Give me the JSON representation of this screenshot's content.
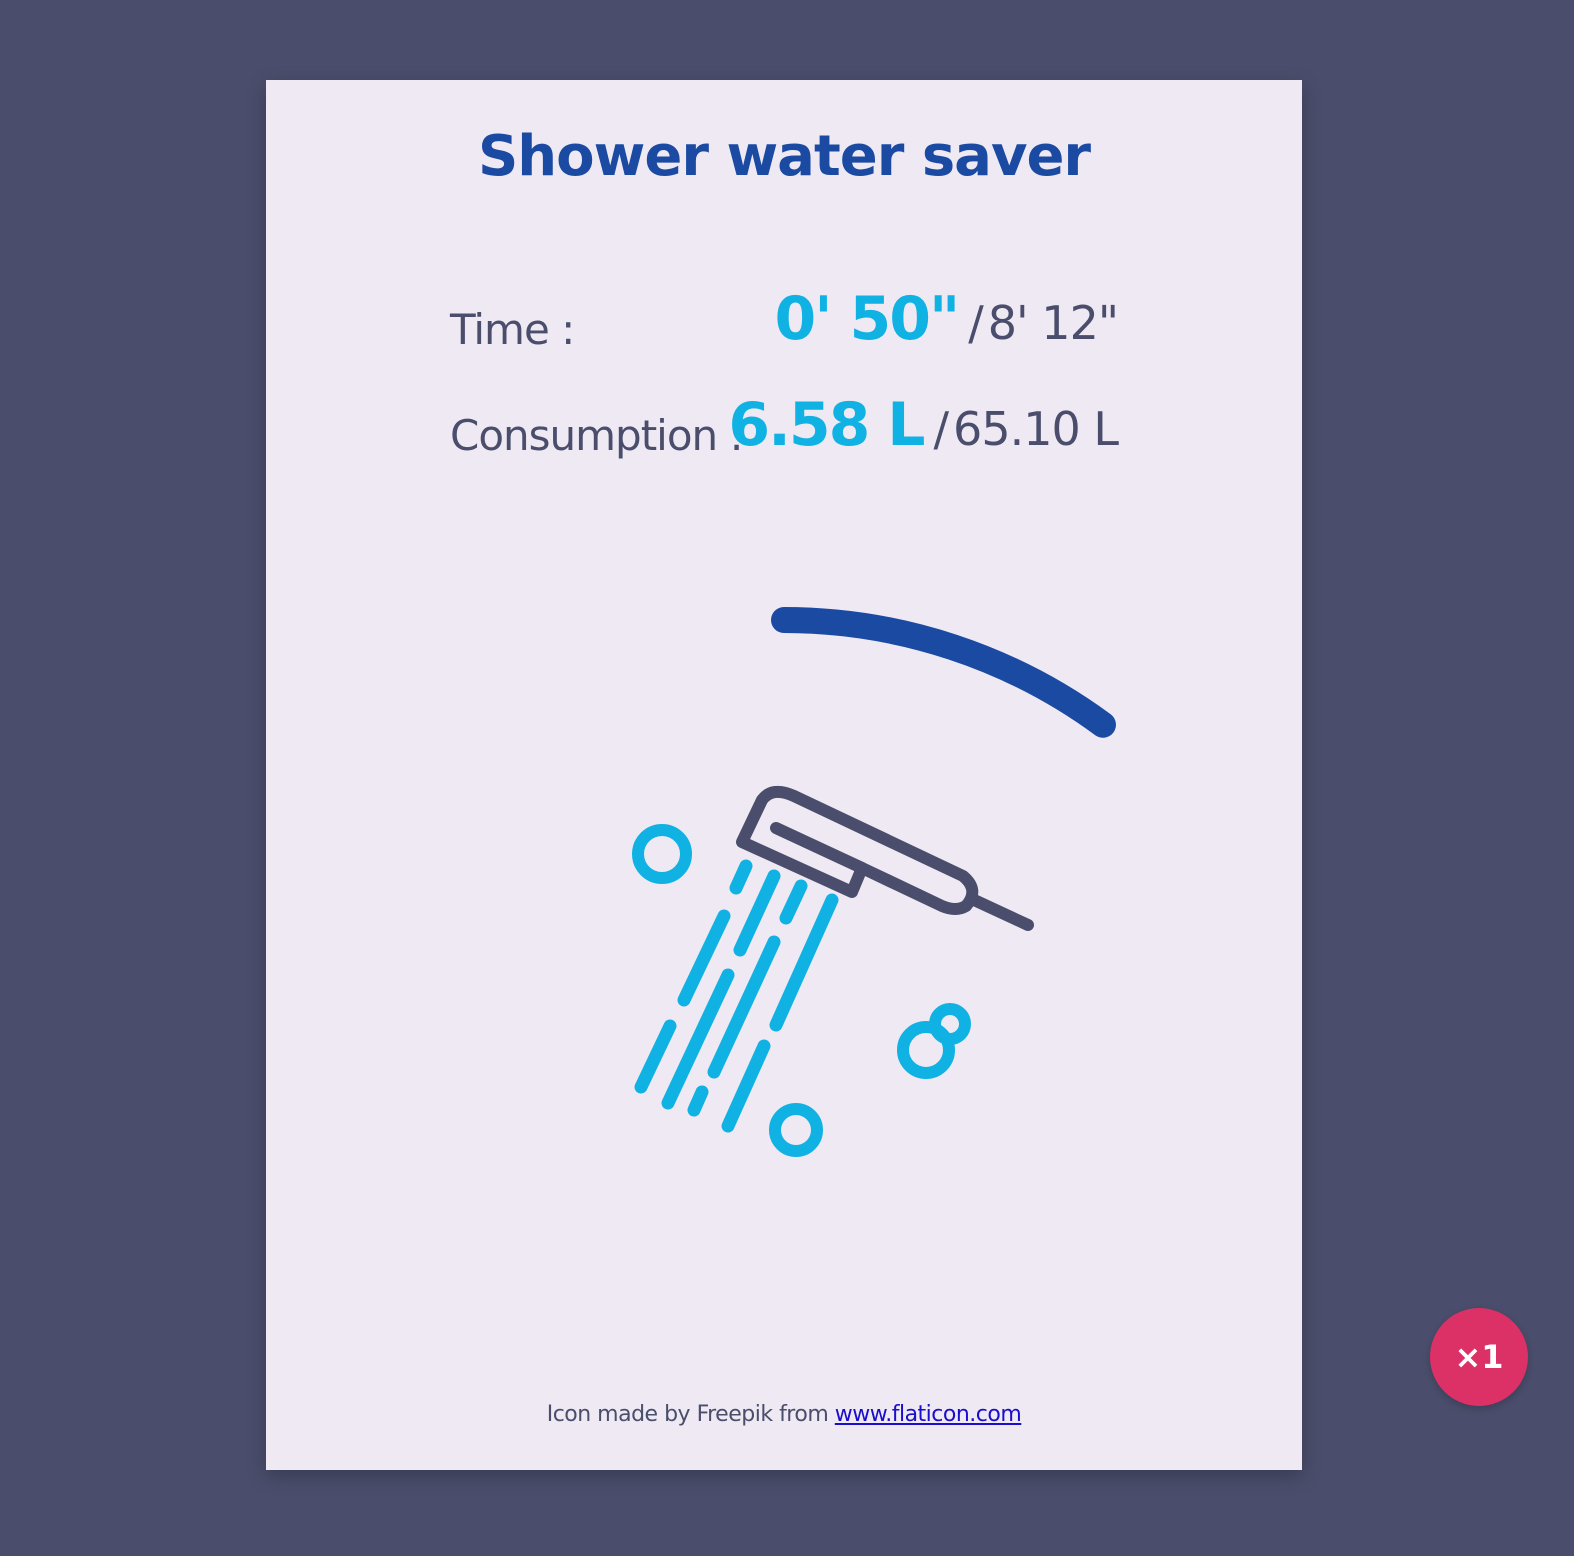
{
  "app": {
    "title": "Shower water saver"
  },
  "stats": {
    "time": {
      "label": "Time :",
      "current": "0' 50\"",
      "separator": "/",
      "total": "8' 12\""
    },
    "consumption": {
      "label": "Consumption :",
      "current": "6.58 L",
      "separator": "/",
      "total": "65.10 L"
    }
  },
  "progress": {
    "fraction": 0.101
  },
  "credit": {
    "prefix": "Icon made by Freepik from ",
    "link_text": "www.flaticon.com"
  },
  "speed_button": {
    "label": "×1"
  },
  "icons": {
    "illustration": "shower-head-icon",
    "progress": "progress-arc"
  },
  "colors": {
    "background": "#4a4e6c",
    "card": "#efe9f3",
    "title": "#1b4aa3",
    "accent": "#10b2e3",
    "text": "#4a4e6c",
    "progress": "#1b4aa3",
    "speed_button": "#dc3166"
  }
}
